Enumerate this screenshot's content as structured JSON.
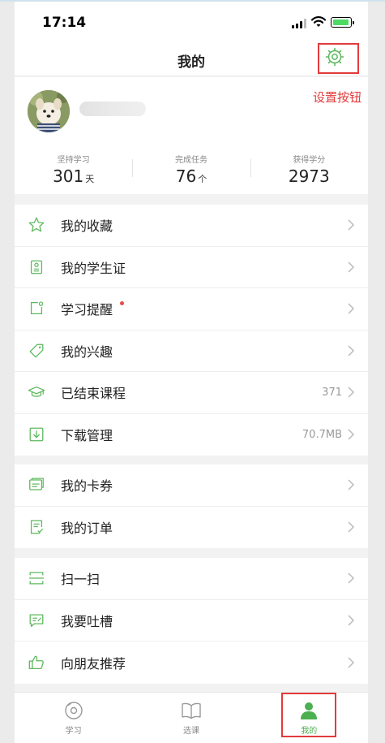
{
  "status_bar": {
    "time": "17:14"
  },
  "nav": {
    "title": "我的"
  },
  "annotation": {
    "text": "设置按钮"
  },
  "stats": [
    {
      "label": "坚持学习",
      "value": "301",
      "unit": "天"
    },
    {
      "label": "完成任务",
      "value": "76",
      "unit": "个"
    },
    {
      "label": "获得学分",
      "value": "2973",
      "unit": ""
    }
  ],
  "menu_group_1": [
    {
      "icon": "star-icon",
      "label": "我的收藏",
      "value": ""
    },
    {
      "icon": "student-card-icon",
      "label": "我的学生证",
      "value": ""
    },
    {
      "icon": "reminder-icon",
      "label": "学习提醒",
      "value": "",
      "badge": true
    },
    {
      "icon": "tag-icon",
      "label": "我的兴趣",
      "value": ""
    },
    {
      "icon": "graduation-cap-icon",
      "label": "已结束课程",
      "value": "371"
    },
    {
      "icon": "download-icon",
      "label": "下载管理",
      "value": "70.7MB"
    }
  ],
  "menu_group_2": [
    {
      "icon": "card-coupon-icon",
      "label": "我的卡券",
      "value": ""
    },
    {
      "icon": "order-icon",
      "label": "我的订单",
      "value": ""
    }
  ],
  "menu_group_3": [
    {
      "icon": "scan-icon",
      "label": "扫一扫",
      "value": ""
    },
    {
      "icon": "feedback-icon",
      "label": "我要吐槽",
      "value": ""
    },
    {
      "icon": "thumbs-up-icon",
      "label": "向朋友推荐",
      "value": ""
    }
  ],
  "tabbar": [
    {
      "label": "学习",
      "active": false
    },
    {
      "label": "选课",
      "active": false
    },
    {
      "label": "我的",
      "active": true
    }
  ],
  "colors": {
    "accent": "#4caf50",
    "annotation": "#e23b3b",
    "icon_green": "#5cb85c"
  }
}
